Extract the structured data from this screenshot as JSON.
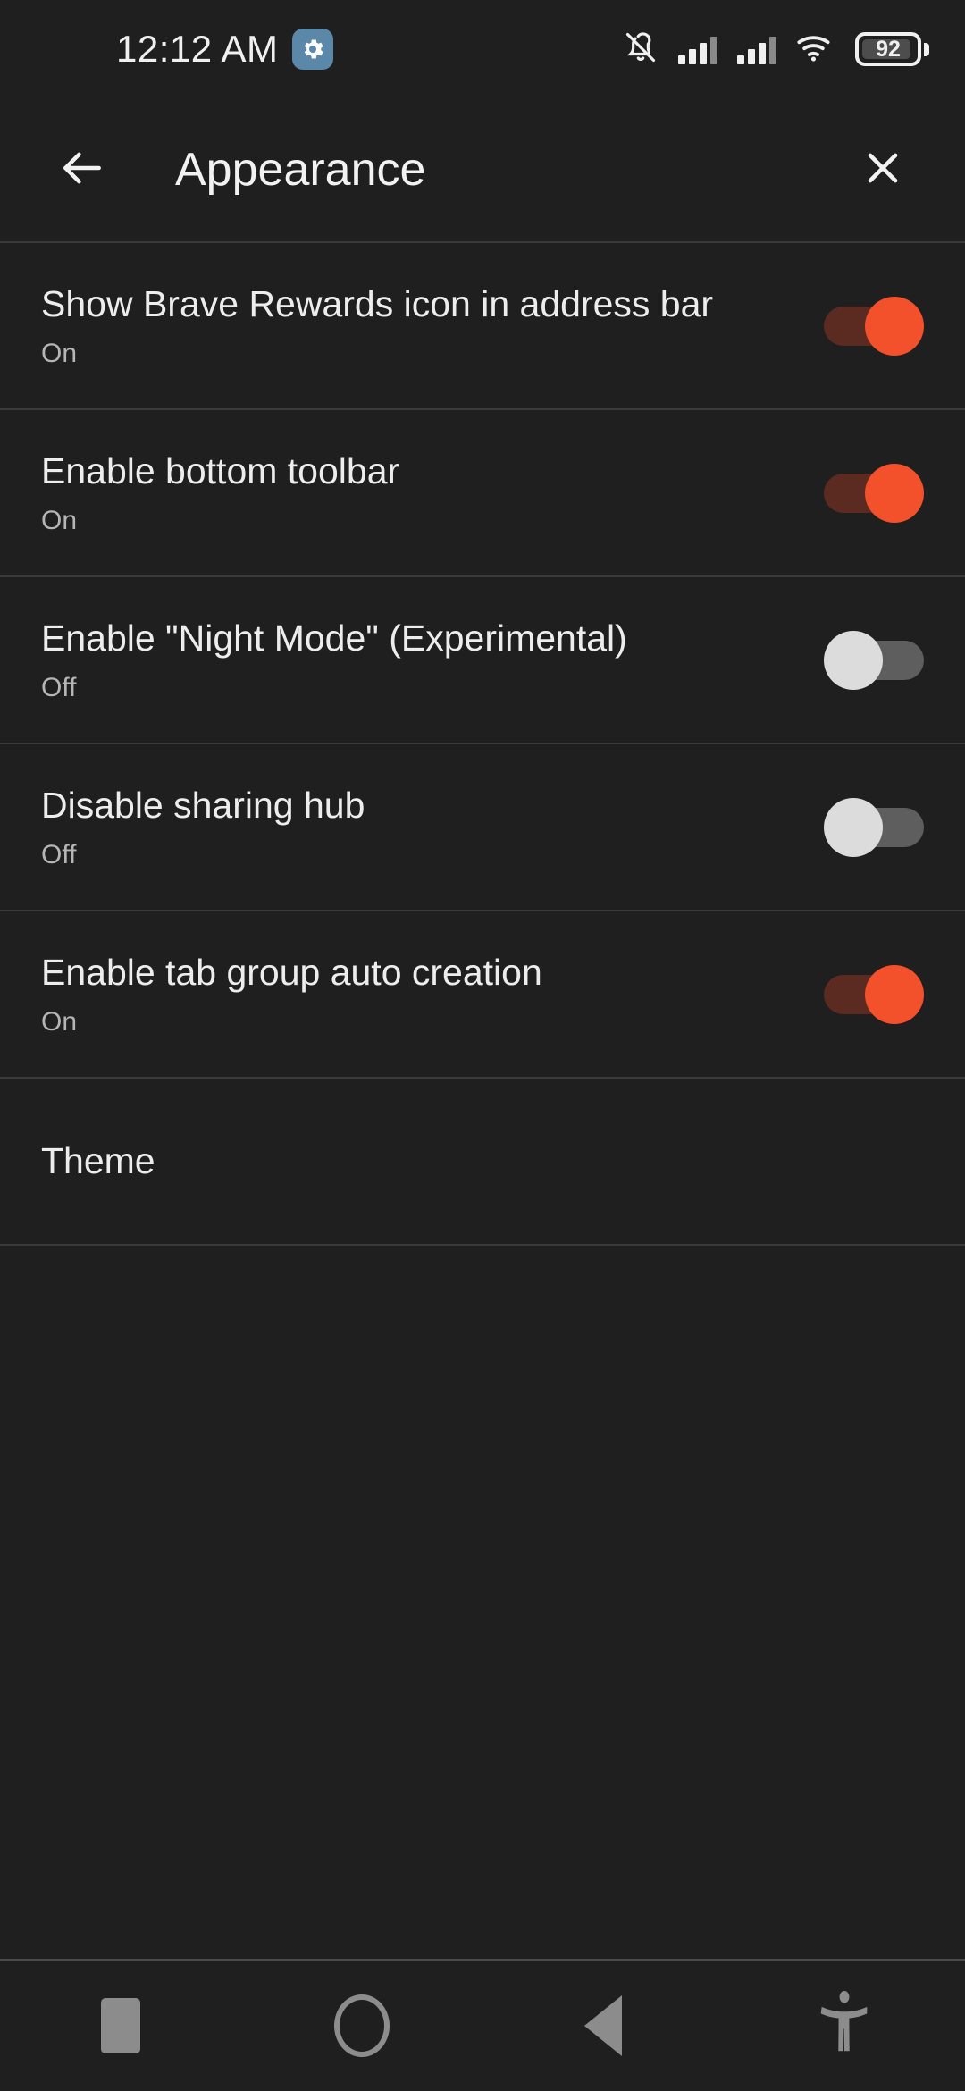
{
  "status_bar": {
    "time": "12:12 AM",
    "gear_badge_icon": "gear-icon",
    "gear_badge_color": "#5b87a8",
    "notifications_icon": "bell-muted-icon",
    "signal_1_icon": "cellular-signal-icon",
    "signal_2_icon": "cellular-signal-icon",
    "wifi_icon": "wifi-icon",
    "battery_icon": "battery-icon",
    "battery_level": "92"
  },
  "app_bar": {
    "back_icon": "arrow-left-icon",
    "title": "Appearance",
    "close_icon": "close-icon"
  },
  "theme": {
    "background": "#1f1f1f",
    "divider": "#3a3a3a",
    "title_text": "#ededed",
    "subtitle_text": "#b5b5b5",
    "toggle_on_thumb": "#f3502c",
    "toggle_on_track": "#5b2a20",
    "toggle_off_thumb": "#dcdcdc",
    "toggle_off_track": "#5e5e5e"
  },
  "settings": [
    {
      "title": "Show Brave Rewards icon in address bar",
      "subtitle": "On",
      "toggle": "on"
    },
    {
      "title": "Enable bottom toolbar",
      "subtitle": "On",
      "toggle": "on"
    },
    {
      "title": "Enable \"Night Mode\" (Experimental)",
      "subtitle": "Off",
      "toggle": "off"
    },
    {
      "title": "Disable sharing hub",
      "subtitle": "Off",
      "toggle": "off"
    },
    {
      "title": "Enable tab group auto creation",
      "subtitle": "On",
      "toggle": "on"
    },
    {
      "title": "Theme",
      "subtitle": "",
      "toggle": null
    }
  ],
  "nav_bar": {
    "recents_icon": "square-recents-icon",
    "home_icon": "circle-home-icon",
    "back_icon": "triangle-back-icon",
    "accessibility_icon": "accessibility-icon"
  }
}
